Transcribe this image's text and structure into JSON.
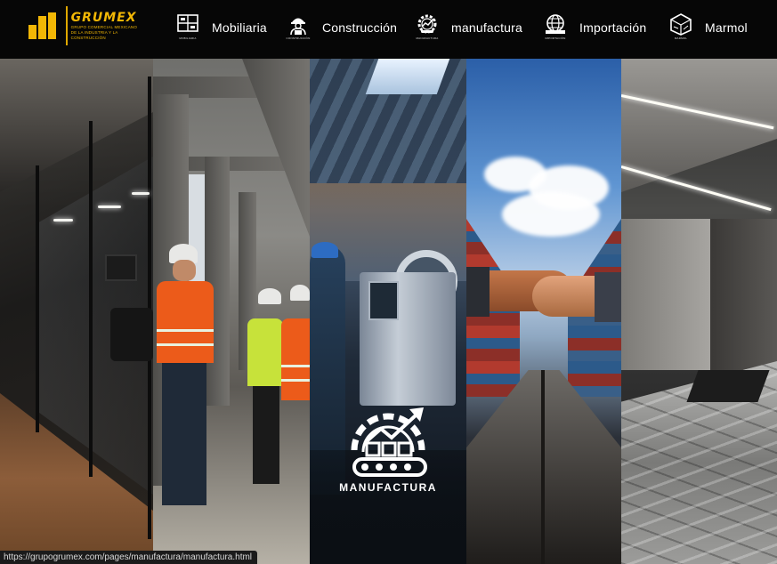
{
  "brand": {
    "name": "GRUMEX",
    "tagline_line1": "GRUPO COMERCIAL MEXICANO",
    "tagline_line2": "DE LA INDUSTRIA Y LA CONSTRUCCIÓN",
    "accent_color": "#f2b705"
  },
  "nav": {
    "items": [
      {
        "label": "Mobiliaria",
        "icon": "furniture-icon",
        "icon_caption": "MOBILIARIA"
      },
      {
        "label": "Construcción",
        "icon": "construction-worker-icon",
        "icon_caption": "CONSTRUCCIÓN"
      },
      {
        "label": "manufactura",
        "icon": "manufacturing-gear-icon",
        "icon_caption": "MANUFACTURA"
      },
      {
        "label": "Importación",
        "icon": "globe-import-icon",
        "icon_caption": "IMPORTACIÓN"
      },
      {
        "label": "Marmol",
        "icon": "marble-block-icon",
        "icon_caption": "MARMOL"
      }
    ]
  },
  "panels": [
    {
      "topic": "office"
    },
    {
      "topic": "construction"
    },
    {
      "topic": "manufacturing",
      "overlay_label": "MANUFACTURA"
    },
    {
      "topic": "import"
    },
    {
      "topic": "marble"
    }
  ],
  "status": {
    "url": "https://grupogrumex.com/pages/manufactura/manufactura.html"
  }
}
